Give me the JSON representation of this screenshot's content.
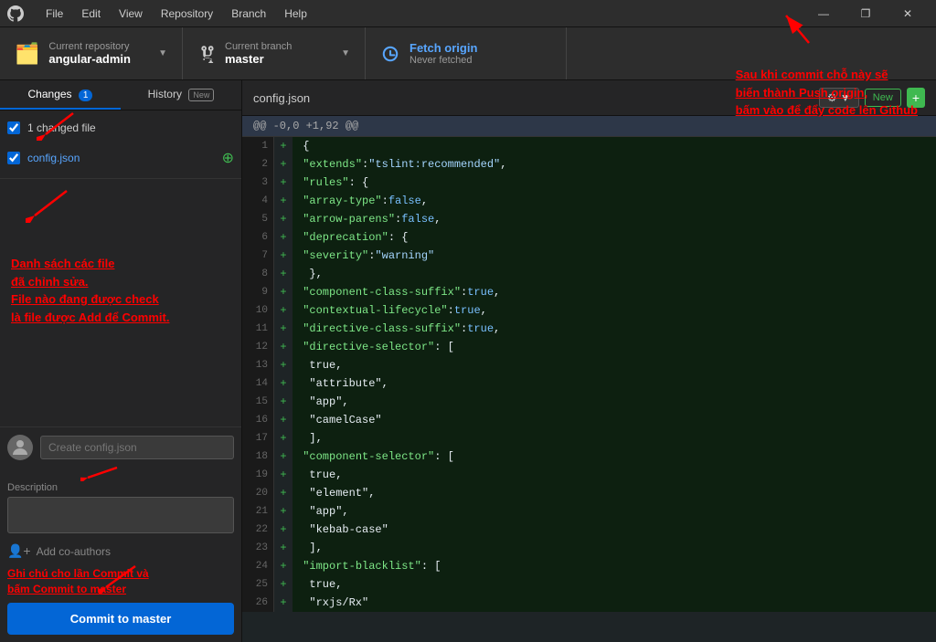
{
  "titlebar": {
    "logo": "⬤",
    "menu": [
      "File",
      "Edit",
      "View",
      "Repository",
      "Branch",
      "Help"
    ],
    "controls": [
      "—",
      "❐",
      "✕"
    ]
  },
  "toolbar": {
    "repo_label": "Current repository",
    "repo_name": "angular-admin",
    "branch_label": "Current branch",
    "branch_name": "master",
    "fetch_label": "Fetch origin",
    "fetch_sub": "Never fetched"
  },
  "sidebar": {
    "tab_changes": "Changes",
    "tab_changes_count": "1",
    "tab_history": "History",
    "tab_history_badge": "New",
    "changed_count": "1 changed file",
    "file_name": "config.json",
    "annotation_text": "Danh sách các file\nđã chỉnh sửa.\nFile nào đang được check\nlà file được Add để Commit.",
    "commit_placeholder": "Create config.json",
    "description_label": "Description",
    "commit_annotation": "Ghi chú cho lần Commit và\nbấm Commit to master",
    "coauthor_label": "Add co-authors",
    "commit_btn_label": "Commit to master"
  },
  "content": {
    "file_tab": "config.json",
    "diff_header": "@@ -0,0 +1,92 @@",
    "fetch_annotation": "Sau khi commit chỗ này sẽ\nbiến thành Push origin,\nbấm vào để đẩy code lên Github",
    "lines": [
      {
        "num": 1,
        "sign": "+",
        "code": "{"
      },
      {
        "num": 2,
        "sign": "+",
        "code": "  \"extends\": \"tslint:recommended\","
      },
      {
        "num": 3,
        "sign": "+",
        "code": "  \"rules\": {"
      },
      {
        "num": 4,
        "sign": "+",
        "code": "    \"array-type\": false,"
      },
      {
        "num": 5,
        "sign": "+",
        "code": "    \"arrow-parens\": false,"
      },
      {
        "num": 6,
        "sign": "+",
        "code": "    \"deprecation\": {"
      },
      {
        "num": 7,
        "sign": "+",
        "code": "      \"severity\": \"warning\""
      },
      {
        "num": 8,
        "sign": "+",
        "code": "    },"
      },
      {
        "num": 9,
        "sign": "+",
        "code": "    \"component-class-suffix\": true,"
      },
      {
        "num": 10,
        "sign": "+",
        "code": "    \"contextual-lifecycle\": true,"
      },
      {
        "num": 11,
        "sign": "+",
        "code": "    \"directive-class-suffix\": true,"
      },
      {
        "num": 12,
        "sign": "+",
        "code": "    \"directive-selector\": ["
      },
      {
        "num": 13,
        "sign": "+",
        "code": "      true,"
      },
      {
        "num": 14,
        "sign": "+",
        "code": "      \"attribute\","
      },
      {
        "num": 15,
        "sign": "+",
        "code": "      \"app\","
      },
      {
        "num": 16,
        "sign": "+",
        "code": "      \"camelCase\""
      },
      {
        "num": 17,
        "sign": "+",
        "code": "    ],"
      },
      {
        "num": 18,
        "sign": "+",
        "code": "    \"component-selector\": ["
      },
      {
        "num": 19,
        "sign": "+",
        "code": "      true,"
      },
      {
        "num": 20,
        "sign": "+",
        "code": "      \"element\","
      },
      {
        "num": 21,
        "sign": "+",
        "code": "      \"app\","
      },
      {
        "num": 22,
        "sign": "+",
        "code": "      \"kebab-case\""
      },
      {
        "num": 23,
        "sign": "+",
        "code": "    ],"
      },
      {
        "num": 24,
        "sign": "+",
        "code": "    \"import-blacklist\": ["
      },
      {
        "num": 25,
        "sign": "+",
        "code": "      true,"
      },
      {
        "num": 26,
        "sign": "+",
        "code": "      \"rxjs/Rx\""
      }
    ]
  }
}
